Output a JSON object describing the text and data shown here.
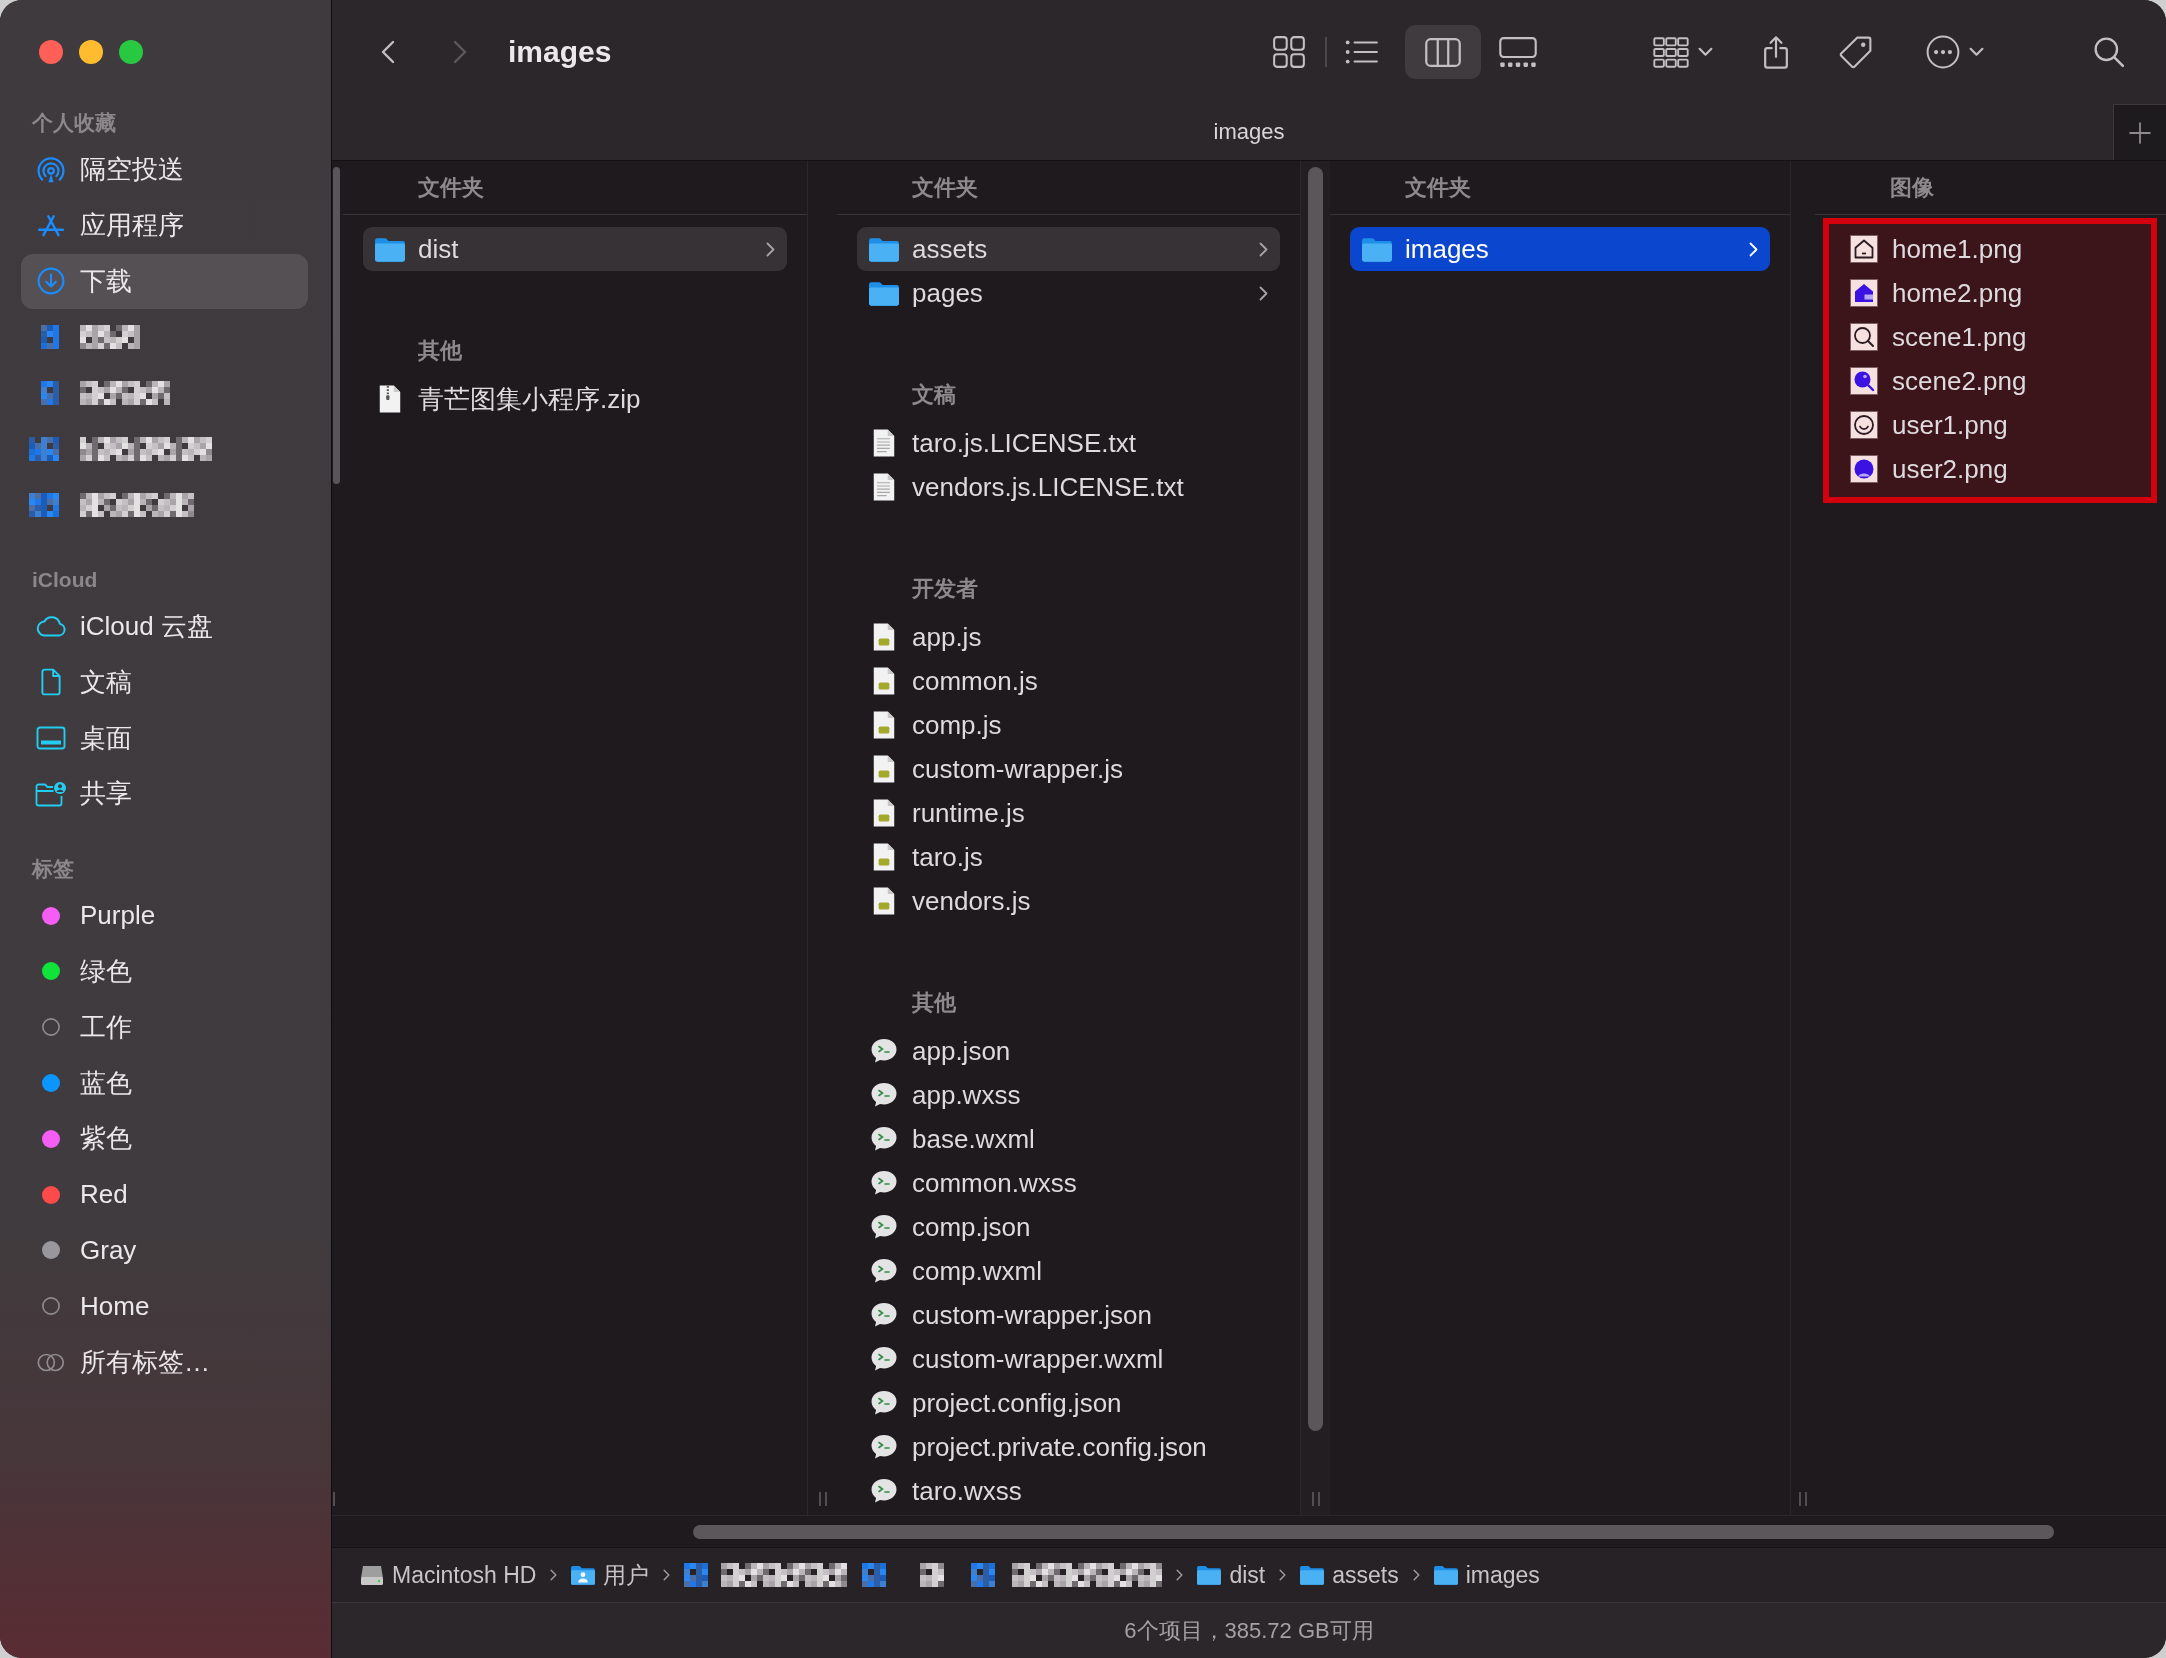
{
  "window": {
    "title": "images",
    "navigation": [
      {
        "kind": "back",
        "disabled": false
      },
      {
        "kind": "forward",
        "disabled": true
      }
    ],
    "view_modes": [
      {
        "kind": "icons",
        "selected": false
      },
      {
        "kind": "list",
        "selected": false
      },
      {
        "kind": "columns",
        "selected": true
      },
      {
        "kind": "gallery",
        "selected": false
      }
    ]
  },
  "tab_bar": {
    "label": "images"
  },
  "sidebar": {
    "sections": [
      {
        "heading": "个人收藏",
        "items": [
          {
            "kind": "airdrop",
            "label": "隔空投送",
            "selected": false
          },
          {
            "kind": "applications",
            "label": "应用程序",
            "selected": false
          },
          {
            "kind": "downloads",
            "label": "下载",
            "selected": true
          },
          {
            "kind": "redacted",
            "selected": false
          },
          {
            "kind": "redacted",
            "selected": false
          },
          {
            "kind": "redacted",
            "selected": false
          },
          {
            "kind": "redacted",
            "selected": false
          }
        ]
      },
      {
        "heading": "iCloud",
        "items": [
          {
            "kind": "cloud",
            "label": "iCloud 云盘",
            "selected": false
          },
          {
            "kind": "documents",
            "label": "文稿",
            "selected": false
          },
          {
            "kind": "desktop",
            "label": "桌面",
            "selected": false
          },
          {
            "kind": "shared",
            "label": "共享",
            "selected": false
          }
        ]
      },
      {
        "heading": "标签",
        "items": [
          {
            "kind": "tag",
            "label": "Purple",
            "color": "#f55ef5",
            "selected": false
          },
          {
            "kind": "tag",
            "label": "绿色",
            "color": "#0fe43a",
            "selected": false
          },
          {
            "kind": "tag",
            "label": "工作",
            "selected": false
          },
          {
            "kind": "tag",
            "label": "蓝色",
            "color": "#0a95ff",
            "selected": false
          },
          {
            "kind": "tag",
            "label": "紫色",
            "color": "#f55ef5",
            "selected": false
          },
          {
            "kind": "tag",
            "label": "Red",
            "color": "#ff4a4a",
            "selected": false
          },
          {
            "kind": "tag",
            "label": "Gray",
            "color": "#99979c",
            "selected": false
          },
          {
            "kind": "tag",
            "label": "Home",
            "selected": false
          },
          {
            "kind": "alltags",
            "label": "所有标签…",
            "selected": false
          }
        ]
      }
    ]
  },
  "columns": [
    {
      "focused": false,
      "groups": [
        {
          "heading": "文件夹",
          "items": [
            {
              "kind": "folder",
              "name": "dist",
              "selected": true
            }
          ]
        },
        {
          "heading": "其他",
          "items": [
            {
              "kind": "zip",
              "name": "青芒图集小程序.zip",
              "selected": false
            }
          ]
        }
      ]
    },
    {
      "focused": false,
      "groups": [
        {
          "heading": "文件夹",
          "items": [
            {
              "kind": "folder",
              "name": "assets",
              "selected": true
            },
            {
              "kind": "folder",
              "name": "pages",
              "selected": false
            }
          ]
        },
        {
          "heading": "文稿",
          "items": [
            {
              "kind": "text",
              "name": "taro.js.LICENSE.txt",
              "selected": false
            },
            {
              "kind": "text",
              "name": "vendors.js.LICENSE.txt",
              "selected": false
            }
          ]
        },
        {
          "heading": "开发者",
          "items": [
            {
              "kind": "script",
              "name": "app.js",
              "selected": false
            },
            {
              "kind": "script",
              "name": "common.js",
              "selected": false
            },
            {
              "kind": "script",
              "name": "comp.js",
              "selected": false
            },
            {
              "kind": "script",
              "name": "custom-wrapper.js",
              "selected": false
            },
            {
              "kind": "script",
              "name": "runtime.js",
              "selected": false
            },
            {
              "kind": "script",
              "name": "taro.js",
              "selected": false
            },
            {
              "kind": "script",
              "name": "vendors.js",
              "selected": false
            }
          ]
        },
        {
          "heading": "其他",
          "items": [
            {
              "kind": "wechat",
              "name": "app.json",
              "selected": false
            },
            {
              "kind": "wechat",
              "name": "app.wxss",
              "selected": false
            },
            {
              "kind": "wechat",
              "name": "base.wxml",
              "selected": false
            },
            {
              "kind": "wechat",
              "name": "common.wxss",
              "selected": false
            },
            {
              "kind": "wechat",
              "name": "comp.json",
              "selected": false
            },
            {
              "kind": "wechat",
              "name": "comp.wxml",
              "selected": false
            },
            {
              "kind": "wechat",
              "name": "custom-wrapper.json",
              "selected": false
            },
            {
              "kind": "wechat",
              "name": "custom-wrapper.wxml",
              "selected": false
            },
            {
              "kind": "wechat",
              "name": "project.config.json",
              "selected": false
            },
            {
              "kind": "wechat",
              "name": "project.private.config.json",
              "selected": false
            },
            {
              "kind": "wechat",
              "name": "taro.wxss",
              "selected": false
            }
          ]
        }
      ]
    },
    {
      "focused": true,
      "groups": [
        {
          "heading": "文件夹",
          "items": [
            {
              "kind": "folder",
              "name": "images",
              "selected": true
            }
          ]
        }
      ]
    },
    {
      "highlighted": true,
      "groups": [
        {
          "heading": "图像",
          "items": [
            {
              "kind": "home",
              "filled": false,
              "name": "home1.png",
              "selected": false
            },
            {
              "kind": "home",
              "filled": true,
              "name": "home2.png",
              "selected": false
            },
            {
              "kind": "search",
              "filled": false,
              "name": "scene1.png",
              "selected": false
            },
            {
              "kind": "search",
              "filled": true,
              "name": "scene2.png",
              "selected": false
            },
            {
              "kind": "user",
              "filled": false,
              "name": "user1.png",
              "selected": false
            },
            {
              "kind": "user",
              "filled": true,
              "name": "user2.png",
              "selected": false
            }
          ]
        }
      ]
    }
  ],
  "path_bar": {
    "items": [
      {
        "kind": "disk",
        "name": "Macintosh HD"
      },
      {
        "kind": "users",
        "name": "用户"
      },
      {
        "kind": "redacted"
      },
      {
        "kind": "folder",
        "name": "dist"
      },
      {
        "kind": "folder",
        "name": "assets"
      },
      {
        "kind": "folder",
        "name": "images"
      }
    ]
  },
  "status_bar": {
    "text": "6个项目，385.72 GB可用"
  }
}
